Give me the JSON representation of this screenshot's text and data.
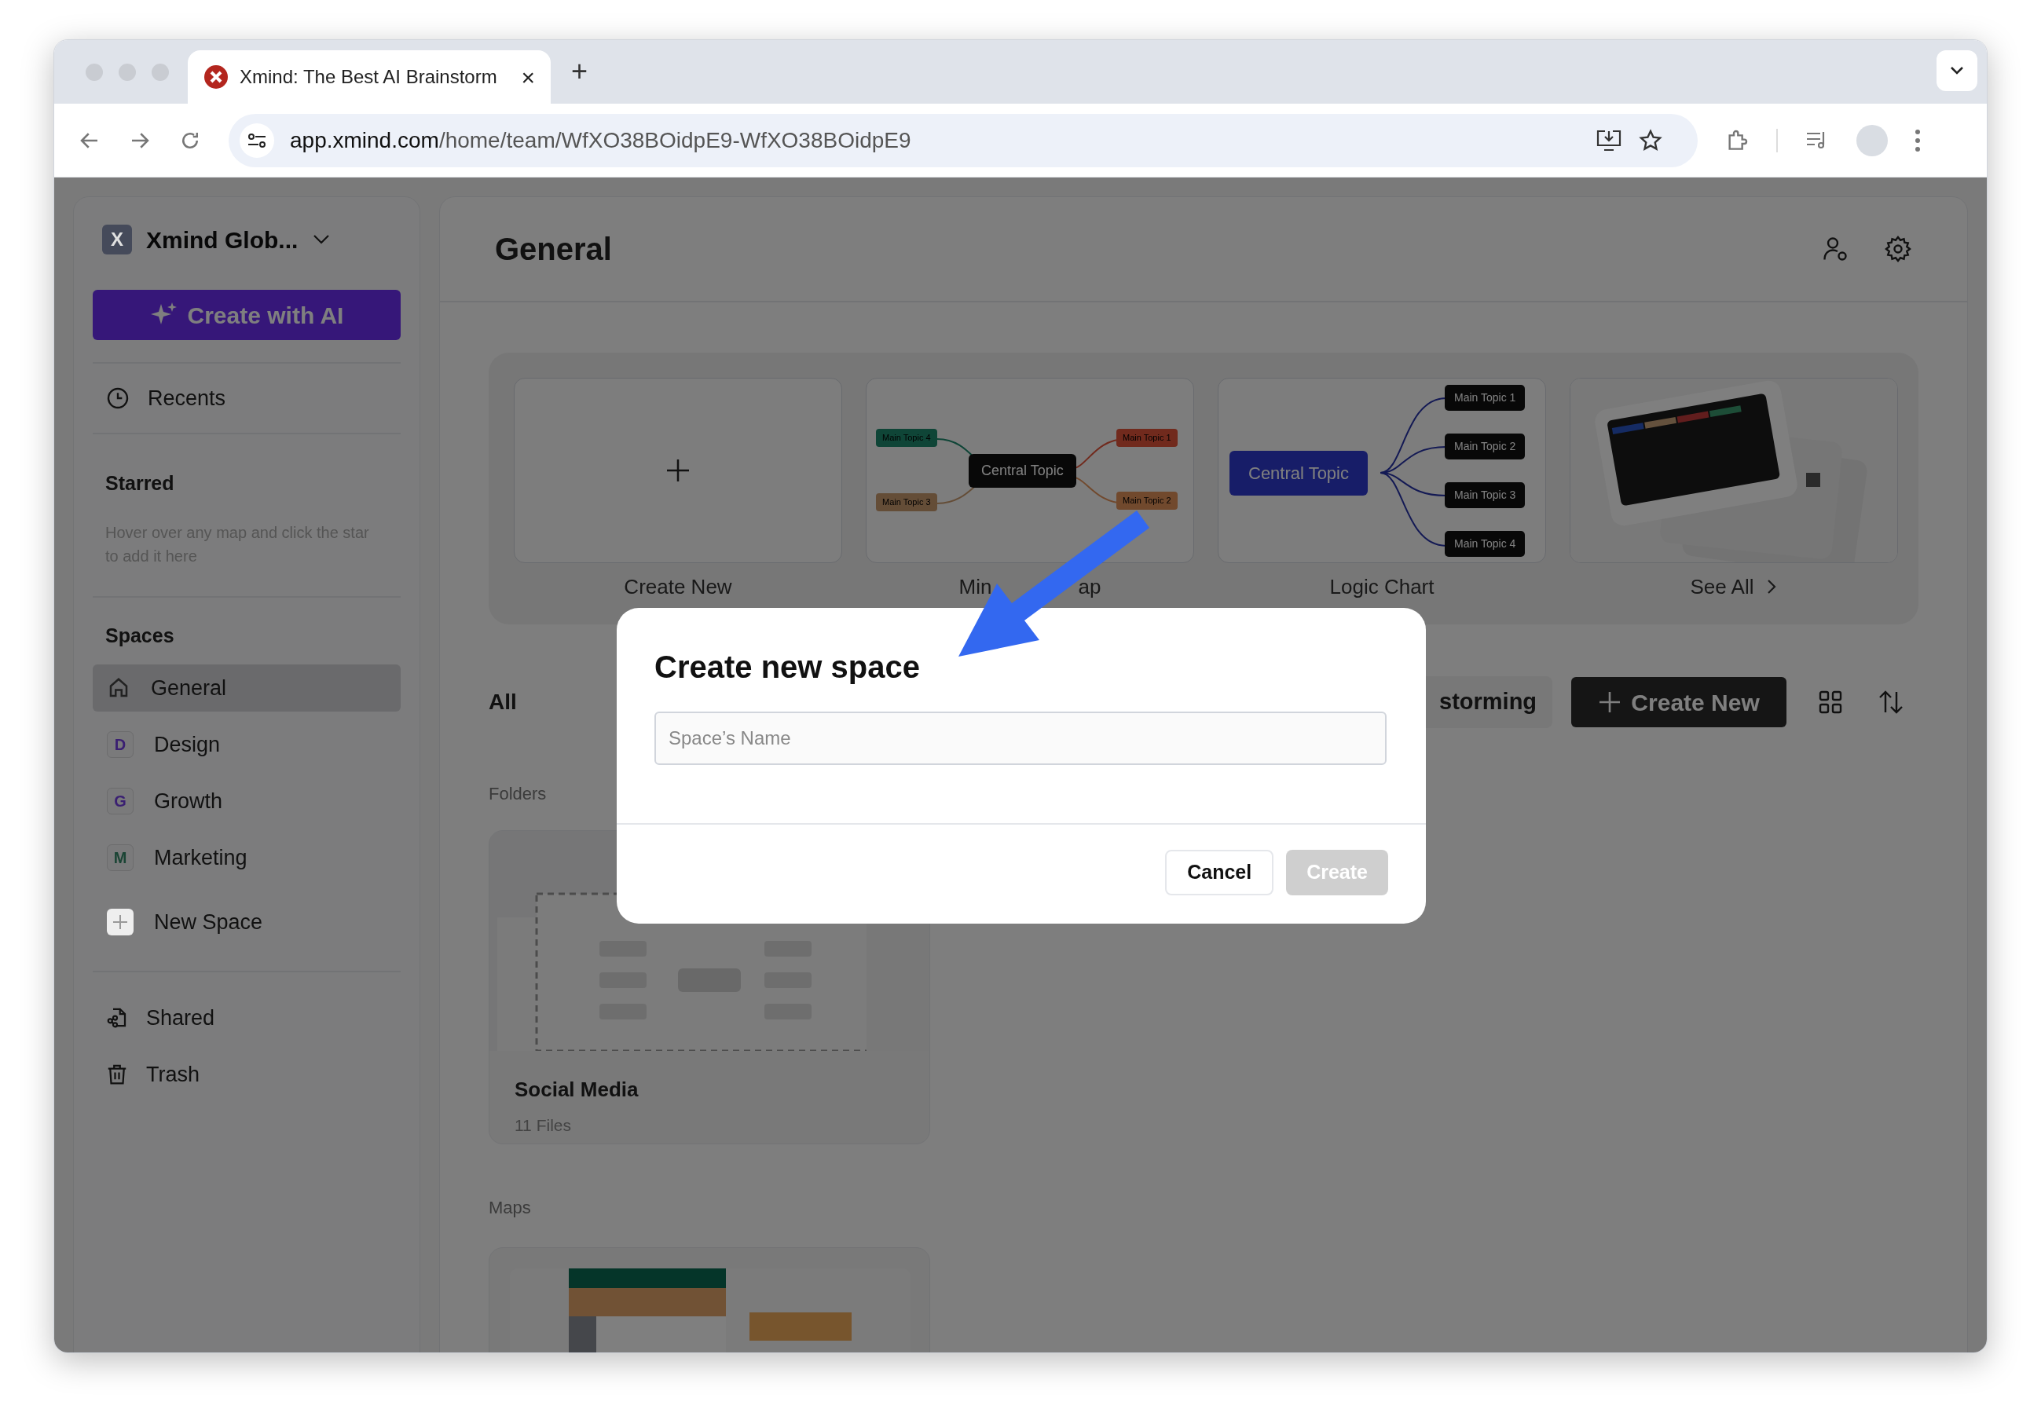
{
  "browser": {
    "tab": {
      "title": "Xmind: The Best AI Brainstorm",
      "close": "×"
    },
    "new_tab": "+",
    "url_host": "app.xmind.com",
    "url_path": "/home/team/WfXO38BOidpE9-WfXO38BOidpE9"
  },
  "sidebar": {
    "workspace": "Xmind Glob...",
    "badge": "X",
    "ai_button": "Create with AI",
    "nav": [
      {
        "kind": "recents",
        "label": "Recents"
      }
    ],
    "starred": {
      "heading": "Starred",
      "hint": "Hover over any map and click the star to add it here"
    },
    "spaces": {
      "heading": "Spaces",
      "items": [
        {
          "kind": "home",
          "label": "General",
          "selected": true
        },
        {
          "kind": "letter",
          "badge": "D",
          "color": "#3a1f72",
          "label": "Design",
          "selected": false
        },
        {
          "kind": "letter",
          "badge": "G",
          "color": "#3a1f72",
          "label": "Growth",
          "selected": false
        },
        {
          "kind": "letter",
          "badge": "M",
          "color": "#1a4434",
          "label": "Marketing",
          "selected": false
        },
        {
          "kind": "add",
          "label": "New Space",
          "selected": false
        }
      ]
    },
    "bottom": [
      {
        "kind": "shared",
        "label": "Shared"
      },
      {
        "kind": "trash",
        "label": "Trash"
      }
    ]
  },
  "main": {
    "title": "General",
    "templates": [
      {
        "kind": "blank",
        "label": "Create New"
      },
      {
        "kind": "mindmap",
        "label_parts": [
          "Min",
          "ap"
        ],
        "central": "Central Topic",
        "topics": [
          "Main Topic 4",
          "Main Topic 1",
          "Main Topic 3",
          "Main Topic 2"
        ]
      },
      {
        "kind": "logic",
        "label": "Logic Chart",
        "central": "Central Topic",
        "topics": [
          "Main Topic 1",
          "Main Topic 2",
          "Main Topic 3",
          "Main Topic 4"
        ]
      },
      {
        "kind": "see_all",
        "label": "See All"
      }
    ],
    "filter": {
      "all": "All",
      "chip": "storming"
    },
    "create_button": "Create New",
    "folders_heading": "Folders",
    "folders": [
      {
        "name": "Social Media",
        "count": "11 Files"
      }
    ],
    "maps_heading": "Maps"
  },
  "dialog": {
    "title": "Create new space",
    "placeholder": "Space’s Name",
    "cancel": "Cancel",
    "create": "Create",
    "create_disabled": true
  }
}
